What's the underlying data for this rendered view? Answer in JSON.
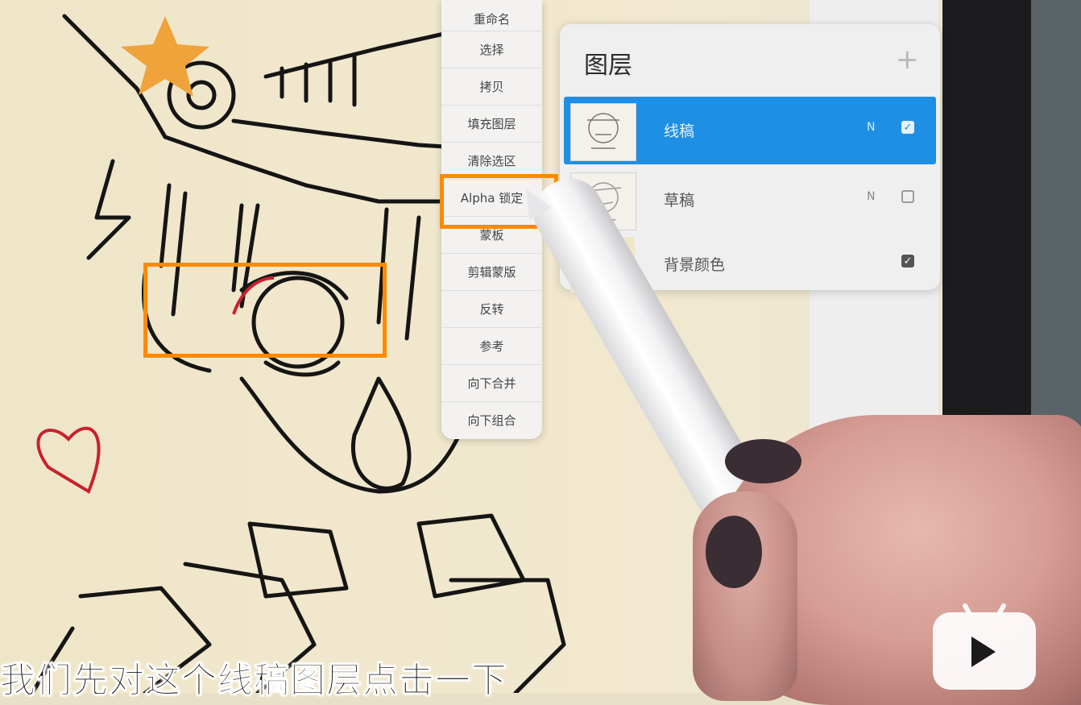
{
  "layer_menu": {
    "items": [
      "重命名",
      "选择",
      "拷贝",
      "填充图层",
      "清除选区",
      "Alpha 锁定",
      "蒙板",
      "剪辑蒙版",
      "反转",
      "参考",
      "向下合并",
      "向下组合"
    ],
    "highlighted_item": "Alpha 锁定"
  },
  "layers_panel": {
    "title": "图层",
    "add_icon": "plus-icon",
    "layers": [
      {
        "name": "线稿",
        "blend": "N",
        "visible": true,
        "selected": true
      },
      {
        "name": "草稿",
        "blend": "N",
        "visible": false,
        "selected": false
      },
      {
        "name": "背景颜色",
        "blend": "",
        "visible": true,
        "selected": false
      }
    ]
  },
  "subtitle": "我们先对这个线稿图层点击一下",
  "watermark": "bilibili-tv-logo",
  "colors": {
    "highlight": "#ff8a00",
    "selected_layer": "#1f8fe6"
  }
}
